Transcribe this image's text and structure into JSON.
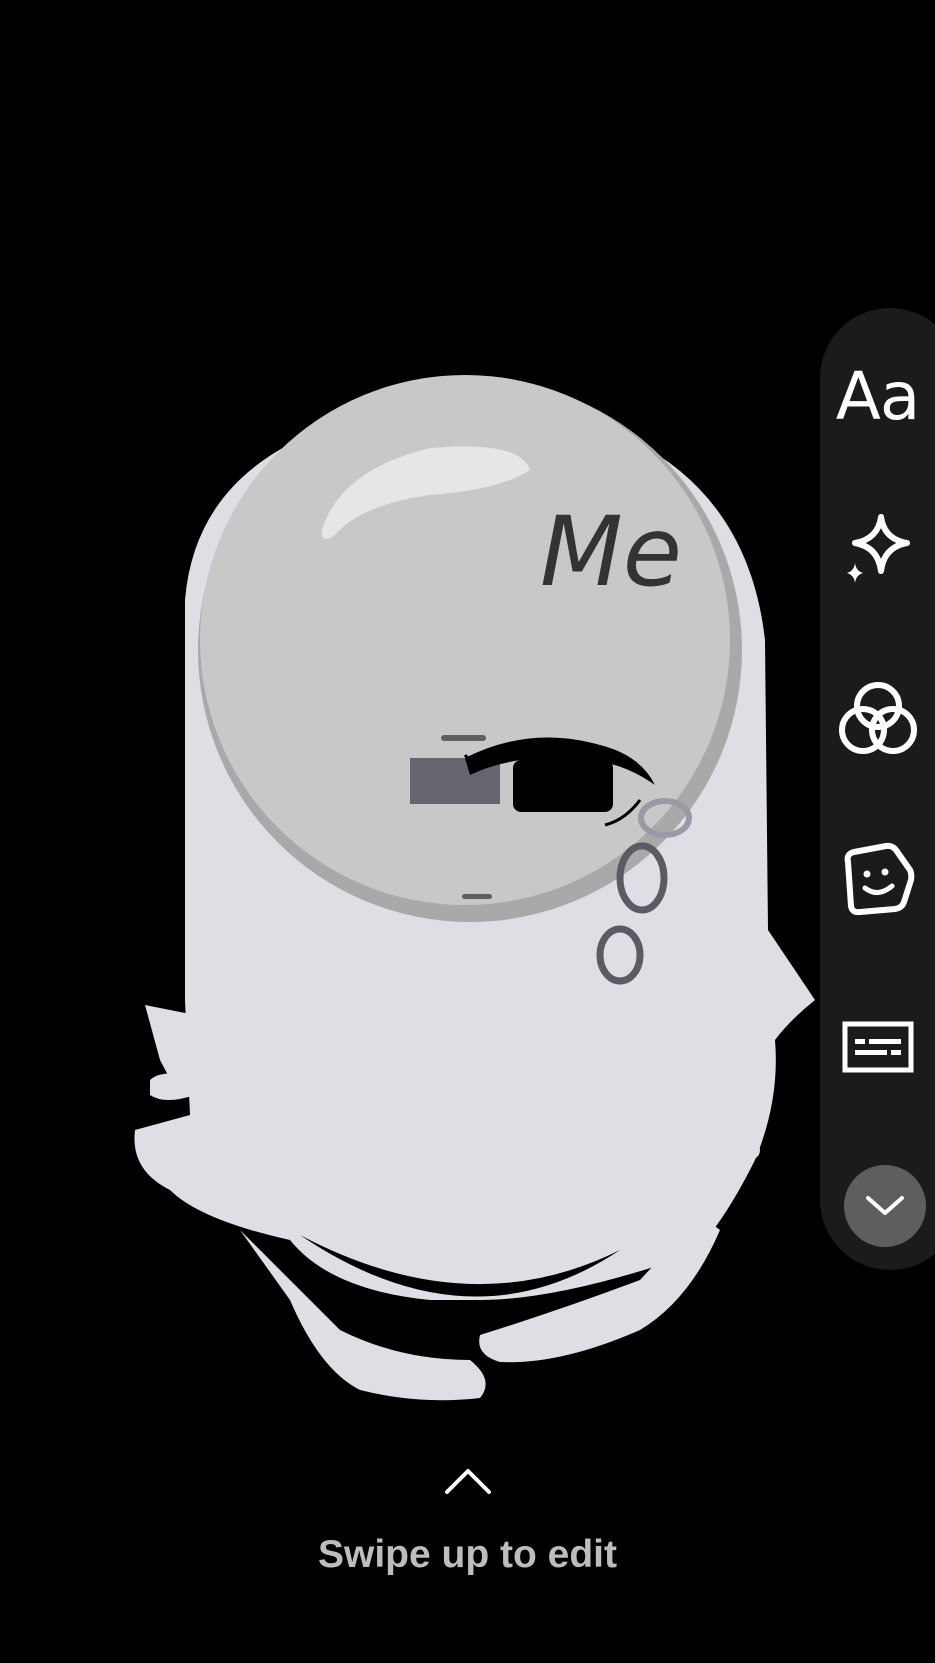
{
  "canvas": {
    "sticker_text": "Me",
    "background_color": "#000000",
    "character_fill": "#dedfe4",
    "bubble_fill": "#c8c8c8"
  },
  "toolbar": {
    "text_tool_label": "Aa",
    "tools": [
      {
        "name": "text",
        "icon": "text-aa-icon"
      },
      {
        "name": "effects",
        "icon": "sparkle-icon"
      },
      {
        "name": "filters",
        "icon": "color-filter-circles-icon"
      },
      {
        "name": "stickers",
        "icon": "sticker-icon"
      },
      {
        "name": "captions",
        "icon": "captions-icon"
      },
      {
        "name": "collapse",
        "icon": "chevron-down-icon"
      }
    ],
    "background_color": "#1b1b1b"
  },
  "footer": {
    "swipe_label": "Swipe up to edit",
    "chevron_icon": "chevron-up-icon"
  }
}
